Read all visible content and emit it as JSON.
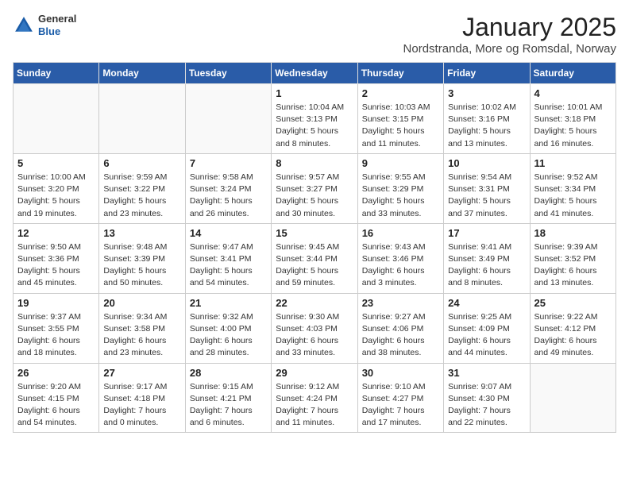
{
  "header": {
    "logo_general": "General",
    "logo_blue": "Blue",
    "month_year": "January 2025",
    "location": "Nordstranda, More og Romsdal, Norway"
  },
  "weekdays": [
    "Sunday",
    "Monday",
    "Tuesday",
    "Wednesday",
    "Thursday",
    "Friday",
    "Saturday"
  ],
  "weeks": [
    [
      {
        "day": "",
        "info": ""
      },
      {
        "day": "",
        "info": ""
      },
      {
        "day": "",
        "info": ""
      },
      {
        "day": "1",
        "info": "Sunrise: 10:04 AM\nSunset: 3:13 PM\nDaylight: 5 hours and 8 minutes."
      },
      {
        "day": "2",
        "info": "Sunrise: 10:03 AM\nSunset: 3:15 PM\nDaylight: 5 hours and 11 minutes."
      },
      {
        "day": "3",
        "info": "Sunrise: 10:02 AM\nSunset: 3:16 PM\nDaylight: 5 hours and 13 minutes."
      },
      {
        "day": "4",
        "info": "Sunrise: 10:01 AM\nSunset: 3:18 PM\nDaylight: 5 hours and 16 minutes."
      }
    ],
    [
      {
        "day": "5",
        "info": "Sunrise: 10:00 AM\nSunset: 3:20 PM\nDaylight: 5 hours and 19 minutes."
      },
      {
        "day": "6",
        "info": "Sunrise: 9:59 AM\nSunset: 3:22 PM\nDaylight: 5 hours and 23 minutes."
      },
      {
        "day": "7",
        "info": "Sunrise: 9:58 AM\nSunset: 3:24 PM\nDaylight: 5 hours and 26 minutes."
      },
      {
        "day": "8",
        "info": "Sunrise: 9:57 AM\nSunset: 3:27 PM\nDaylight: 5 hours and 30 minutes."
      },
      {
        "day": "9",
        "info": "Sunrise: 9:55 AM\nSunset: 3:29 PM\nDaylight: 5 hours and 33 minutes."
      },
      {
        "day": "10",
        "info": "Sunrise: 9:54 AM\nSunset: 3:31 PM\nDaylight: 5 hours and 37 minutes."
      },
      {
        "day": "11",
        "info": "Sunrise: 9:52 AM\nSunset: 3:34 PM\nDaylight: 5 hours and 41 minutes."
      }
    ],
    [
      {
        "day": "12",
        "info": "Sunrise: 9:50 AM\nSunset: 3:36 PM\nDaylight: 5 hours and 45 minutes."
      },
      {
        "day": "13",
        "info": "Sunrise: 9:48 AM\nSunset: 3:39 PM\nDaylight: 5 hours and 50 minutes."
      },
      {
        "day": "14",
        "info": "Sunrise: 9:47 AM\nSunset: 3:41 PM\nDaylight: 5 hours and 54 minutes."
      },
      {
        "day": "15",
        "info": "Sunrise: 9:45 AM\nSunset: 3:44 PM\nDaylight: 5 hours and 59 minutes."
      },
      {
        "day": "16",
        "info": "Sunrise: 9:43 AM\nSunset: 3:46 PM\nDaylight: 6 hours and 3 minutes."
      },
      {
        "day": "17",
        "info": "Sunrise: 9:41 AM\nSunset: 3:49 PM\nDaylight: 6 hours and 8 minutes."
      },
      {
        "day": "18",
        "info": "Sunrise: 9:39 AM\nSunset: 3:52 PM\nDaylight: 6 hours and 13 minutes."
      }
    ],
    [
      {
        "day": "19",
        "info": "Sunrise: 9:37 AM\nSunset: 3:55 PM\nDaylight: 6 hours and 18 minutes."
      },
      {
        "day": "20",
        "info": "Sunrise: 9:34 AM\nSunset: 3:58 PM\nDaylight: 6 hours and 23 minutes."
      },
      {
        "day": "21",
        "info": "Sunrise: 9:32 AM\nSunset: 4:00 PM\nDaylight: 6 hours and 28 minutes."
      },
      {
        "day": "22",
        "info": "Sunrise: 9:30 AM\nSunset: 4:03 PM\nDaylight: 6 hours and 33 minutes."
      },
      {
        "day": "23",
        "info": "Sunrise: 9:27 AM\nSunset: 4:06 PM\nDaylight: 6 hours and 38 minutes."
      },
      {
        "day": "24",
        "info": "Sunrise: 9:25 AM\nSunset: 4:09 PM\nDaylight: 6 hours and 44 minutes."
      },
      {
        "day": "25",
        "info": "Sunrise: 9:22 AM\nSunset: 4:12 PM\nDaylight: 6 hours and 49 minutes."
      }
    ],
    [
      {
        "day": "26",
        "info": "Sunrise: 9:20 AM\nSunset: 4:15 PM\nDaylight: 6 hours and 54 minutes."
      },
      {
        "day": "27",
        "info": "Sunrise: 9:17 AM\nSunset: 4:18 PM\nDaylight: 7 hours and 0 minutes."
      },
      {
        "day": "28",
        "info": "Sunrise: 9:15 AM\nSunset: 4:21 PM\nDaylight: 7 hours and 6 minutes."
      },
      {
        "day": "29",
        "info": "Sunrise: 9:12 AM\nSunset: 4:24 PM\nDaylight: 7 hours and 11 minutes."
      },
      {
        "day": "30",
        "info": "Sunrise: 9:10 AM\nSunset: 4:27 PM\nDaylight: 7 hours and 17 minutes."
      },
      {
        "day": "31",
        "info": "Sunrise: 9:07 AM\nSunset: 4:30 PM\nDaylight: 7 hours and 22 minutes."
      },
      {
        "day": "",
        "info": ""
      }
    ]
  ]
}
